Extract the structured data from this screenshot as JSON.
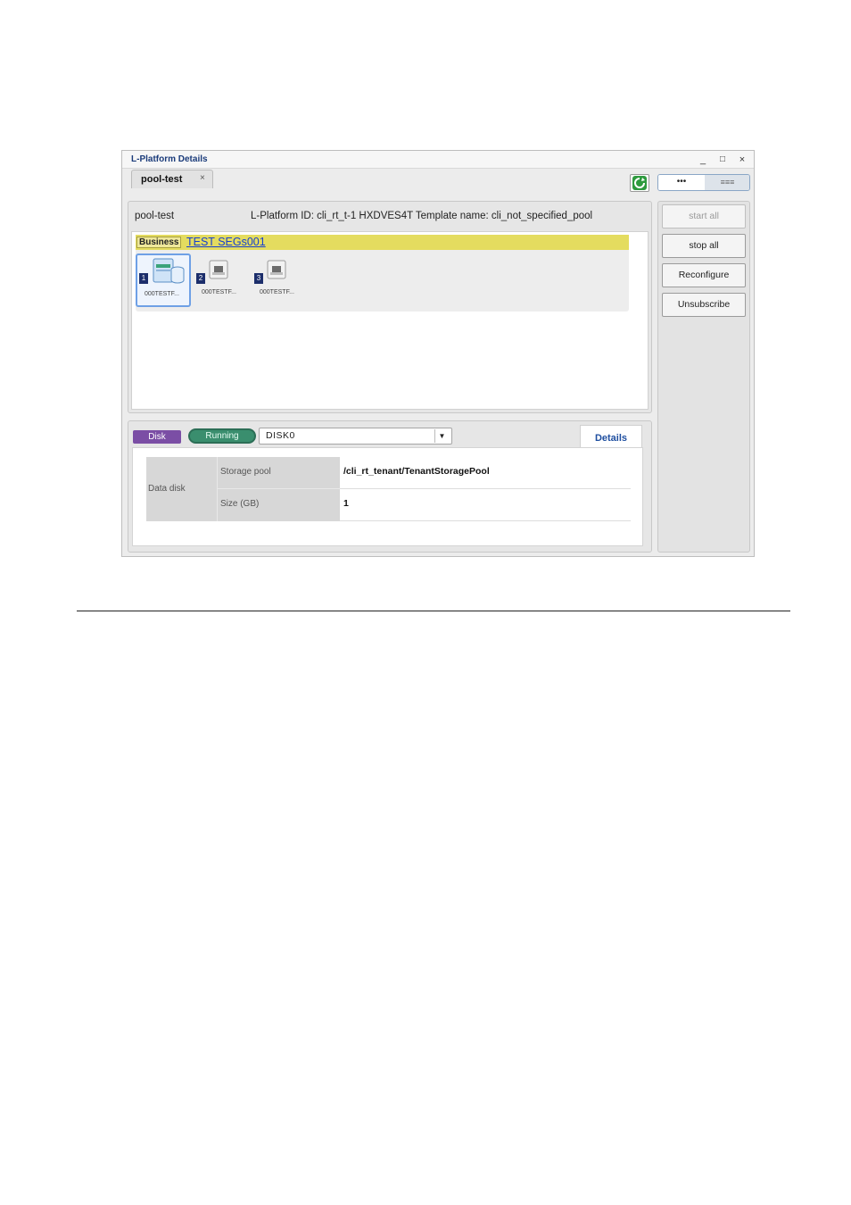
{
  "window": {
    "title": "L-Platform Details",
    "controls": {
      "minimize": "_",
      "maximize": "□",
      "close": "×"
    },
    "tab": {
      "label": "pool-test",
      "close": "×"
    },
    "view_toggle": {
      "left": "•••",
      "right": "≡≡≡"
    }
  },
  "summary": {
    "name": "pool-test",
    "id_line": "L-Platform ID: cli_rt_t-1 HXDVES4T   Template name: cli_not_specified_pool"
  },
  "segment": {
    "type": "Business",
    "name": "TEST SEGs001"
  },
  "servers": [
    {
      "number": "1",
      "label": "000TESTF...",
      "selected": true
    },
    {
      "number": "2",
      "label": "000TESTF...",
      "selected": false
    },
    {
      "number": "3",
      "label": "000TESTF...",
      "selected": false
    }
  ],
  "actions": {
    "start_all": "start all",
    "stop_all": "stop all",
    "reconfigure": "Reconfigure",
    "unsubscribe": "Unsubscribe"
  },
  "detail": {
    "badge": "Disk",
    "status": "Running",
    "disk_select": "DISK0",
    "details_tab": "Details",
    "row_header": "Data disk",
    "rows": [
      {
        "label": "Storage pool",
        "value": "/cli_rt_tenant/TenantStoragePool"
      },
      {
        "label": "Size (GB)",
        "value": "1"
      }
    ]
  },
  "colors": {
    "segment_bar": "#e4dc5f",
    "disk_badge": "#7b4ea5",
    "status_running": "#3a8e6e",
    "link": "#1740d0"
  }
}
